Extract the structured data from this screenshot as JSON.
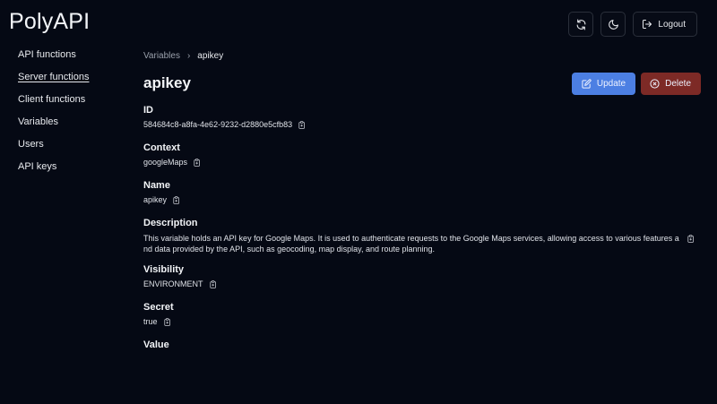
{
  "app": {
    "title": "PolyAPI"
  },
  "header": {
    "logout_label": "Logout"
  },
  "sidebar": {
    "items": [
      {
        "label": "API functions"
      },
      {
        "label": "Server functions"
      },
      {
        "label": "Client functions"
      },
      {
        "label": "Variables"
      },
      {
        "label": "Users"
      },
      {
        "label": "API keys"
      }
    ]
  },
  "breadcrumb": {
    "parent": "Variables",
    "separator": "›",
    "current": "apikey"
  },
  "page": {
    "title": "apikey"
  },
  "actions": {
    "update_label": "Update",
    "delete_label": "Delete"
  },
  "fields": {
    "id": {
      "label": "ID",
      "value": "584684c8-a8fa-4e62-9232-d2880e5cfb83"
    },
    "context": {
      "label": "Context",
      "value": "googleMaps"
    },
    "name": {
      "label": "Name",
      "value": "apikey"
    },
    "description": {
      "label": "Description",
      "value": "This variable holds an API key for Google Maps. It is used to authenticate requests to the Google Maps services, allowing access to various features and data provided by the API, such as geocoding, map display, and route planning."
    },
    "visibility": {
      "label": "Visibility",
      "value": "ENVIRONMENT"
    },
    "secret": {
      "label": "Secret",
      "value": "true"
    },
    "value": {
      "label": "Value"
    }
  },
  "colors": {
    "background": "#050914",
    "update_button": "#4c7fe3",
    "delete_button": "#7d2a26"
  },
  "icons": {
    "refresh": "refresh-icon",
    "theme": "moon-icon",
    "logout": "logout-icon",
    "update": "edit-icon",
    "delete": "x-circle-icon",
    "copy": "copy-icon"
  }
}
